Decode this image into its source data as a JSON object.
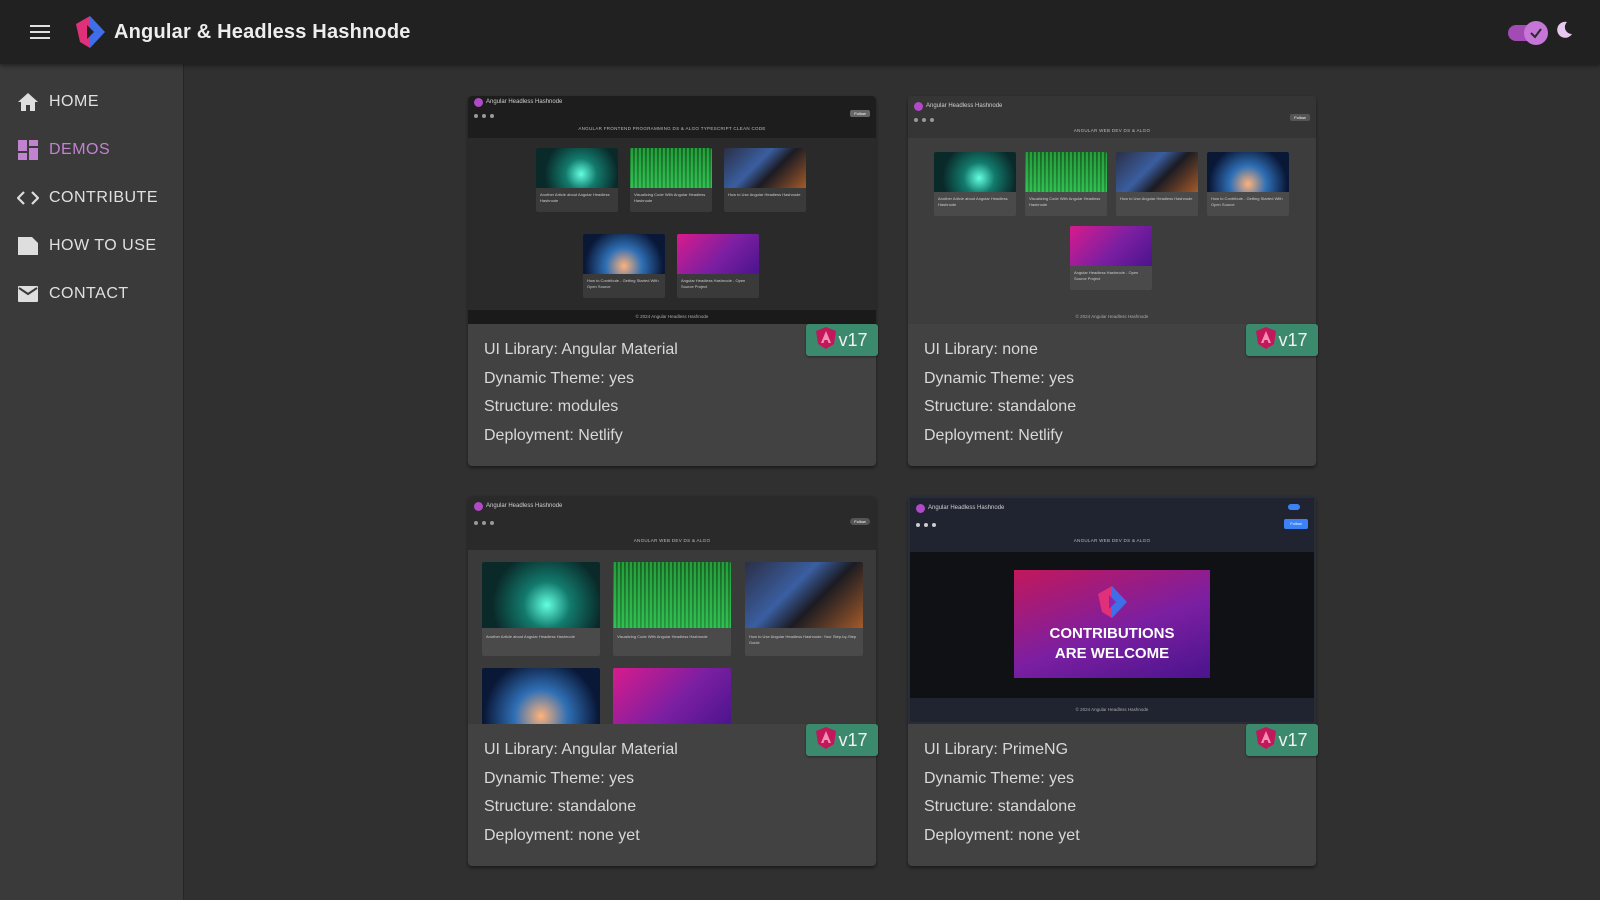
{
  "app": {
    "title": "Angular & Headless Hashnode",
    "menu_icon": "menu-icon",
    "logo_icon": "app-logo-icon"
  },
  "theme_toggle": {
    "state": "on",
    "icons": [
      "check-icon",
      "moon-icon"
    ],
    "accent_color": "#a24bb4"
  },
  "sidebar": {
    "items": [
      {
        "label": "HOME",
        "icon": "home-icon",
        "active": false
      },
      {
        "label": "DEMOS",
        "icon": "dashboard-icon",
        "active": true
      },
      {
        "label": "CONTRIBUTE",
        "icon": "code-icon",
        "active": false
      },
      {
        "label": "HOW TO USE",
        "icon": "label-icon",
        "active": false
      },
      {
        "label": "CONTACT",
        "icon": "mail-icon",
        "active": false
      }
    ],
    "active_color": "#c183cf"
  },
  "demos": [
    {
      "ui_library": "UI Library: Angular Material",
      "dynamic_theme": "Dynamic Theme: yes",
      "structure": "Structure: modules",
      "deployment": "Deployment: Netlify",
      "version": "v17",
      "preview": {
        "title": "Angular Headless Hashnode",
        "nav": "ANGULAR   FRONTEND   PROGRAMMING   DS & ALGO   TYPESCRIPT   CLEAN CODE",
        "footer": "© 2024 Angular Headless Hashnode"
      }
    },
    {
      "ui_library": "UI Library: none",
      "dynamic_theme": "Dynamic Theme: yes",
      "structure": "Structure: standalone",
      "deployment": "Deployment: Netlify",
      "version": "v17",
      "preview": {
        "title": "Angular Headless Hashnode",
        "nav": "ANGULAR   WEB DEV   DS & ALGO",
        "footer": "© 2024 Angular Headless Hashnode"
      }
    },
    {
      "ui_library": "UI Library: Angular Material",
      "dynamic_theme": "Dynamic Theme: yes",
      "structure": "Structure: standalone",
      "deployment": "Deployment: none yet",
      "version": "v17",
      "preview": {
        "title": "Angular Headless Hashnode",
        "nav": "ANGULAR   WEB DEV   DS & ALGO",
        "footer": ""
      }
    },
    {
      "ui_library": "UI Library: PrimeNG",
      "dynamic_theme": "Dynamic Theme: yes",
      "structure": "Structure: standalone",
      "deployment": "Deployment: none yet",
      "version": "v17",
      "preview": {
        "title": "Angular Headless Hashnode",
        "nav": "ANGULAR   WEB DEV   DS & ALGO",
        "banner": "CONTRIBUTIONS ARE WELCOME",
        "footer": "© 2024 Angular Headless Hashnode"
      }
    }
  ],
  "badge_color": "#3c8a6e"
}
